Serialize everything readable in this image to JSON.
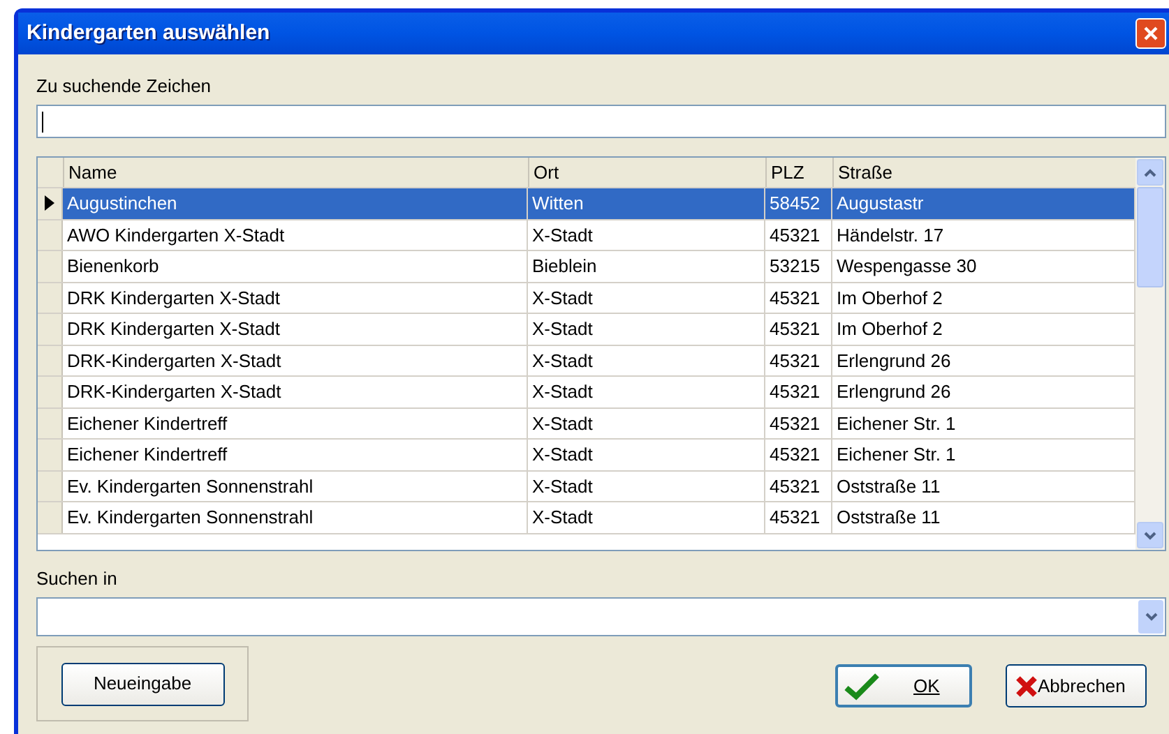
{
  "window": {
    "title": "Kindergarten auswählen"
  },
  "search": {
    "label": "Zu suchende Zeichen"
  },
  "table": {
    "columns": [
      "Name",
      "Ort",
      "PLZ",
      "Straße"
    ],
    "rows": [
      {
        "cells": [
          "Augustinchen",
          "Witten",
          "58452",
          "Augustastr"
        ],
        "selected": true
      },
      {
        "cells": [
          "AWO Kindergarten X-Stadt",
          "X-Stadt",
          "45321",
          "Händelstr. 17"
        ],
        "selected": false
      },
      {
        "cells": [
          "Bienenkorb",
          "Bieblein",
          "53215",
          "Wespengasse 30"
        ],
        "selected": false
      },
      {
        "cells": [
          "DRK Kindergarten X-Stadt",
          "X-Stadt",
          "45321",
          "Im Oberhof 2"
        ],
        "selected": false
      },
      {
        "cells": [
          "DRK Kindergarten X-Stadt",
          "X-Stadt",
          "45321",
          "Im Oberhof 2"
        ],
        "selected": false
      },
      {
        "cells": [
          "DRK-Kindergarten X-Stadt",
          "X-Stadt",
          "45321",
          "Erlengrund 26"
        ],
        "selected": false
      },
      {
        "cells": [
          "DRK-Kindergarten X-Stadt",
          "X-Stadt",
          "45321",
          "Erlengrund 26"
        ],
        "selected": false
      },
      {
        "cells": [
          "Eichener Kindertreff",
          "X-Stadt",
          "45321",
          "Eichener Str. 1"
        ],
        "selected": false
      },
      {
        "cells": [
          "Eichener Kindertreff",
          "X-Stadt",
          "45321",
          "Eichener Str. 1"
        ],
        "selected": false
      },
      {
        "cells": [
          "Ev. Kindergarten Sonnenstrahl",
          "X-Stadt",
          "45321",
          "Oststraße 11"
        ],
        "selected": false
      },
      {
        "cells": [
          "Ev. Kindergarten Sonnenstrahl",
          "X-Stadt",
          "45321",
          "Oststraße 11"
        ],
        "selected": false
      }
    ]
  },
  "search_in": {
    "label": "Suchen in"
  },
  "buttons": {
    "new": "Neueingabe",
    "ok": "OK",
    "cancel": "Abbrechen"
  }
}
